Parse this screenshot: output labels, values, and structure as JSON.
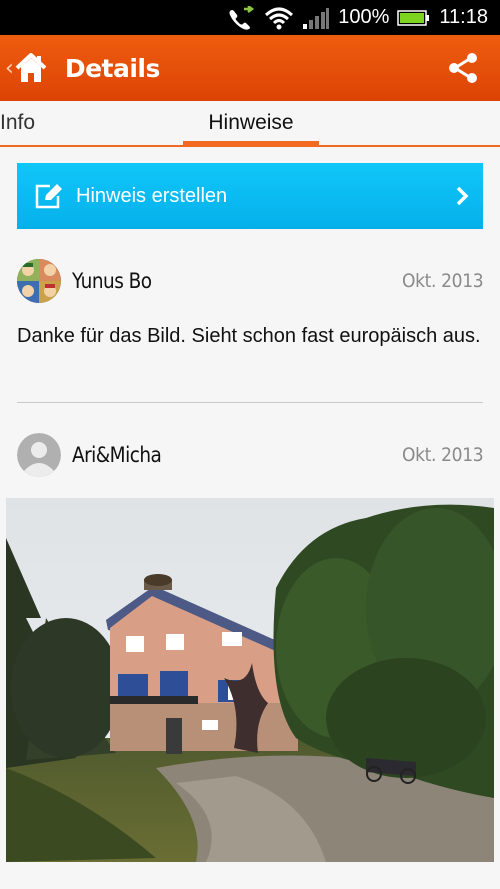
{
  "status_bar": {
    "battery": "100%",
    "time": "11:18"
  },
  "action_bar": {
    "title": "Details"
  },
  "tabs": [
    {
      "label": "Info"
    },
    {
      "label": "Hinweise"
    }
  ],
  "create_button": {
    "label": "Hinweis erstellen"
  },
  "comments": [
    {
      "author": "Yunus Bo",
      "date": "Okt. 2013",
      "text": "Danke für das Bild. Sieht schon fast europäisch aus."
    },
    {
      "author": "Ari&Micha",
      "date": "Okt. 2013"
    }
  ],
  "colors": {
    "accent": "#e14a06",
    "button": "#0bbdf3"
  }
}
